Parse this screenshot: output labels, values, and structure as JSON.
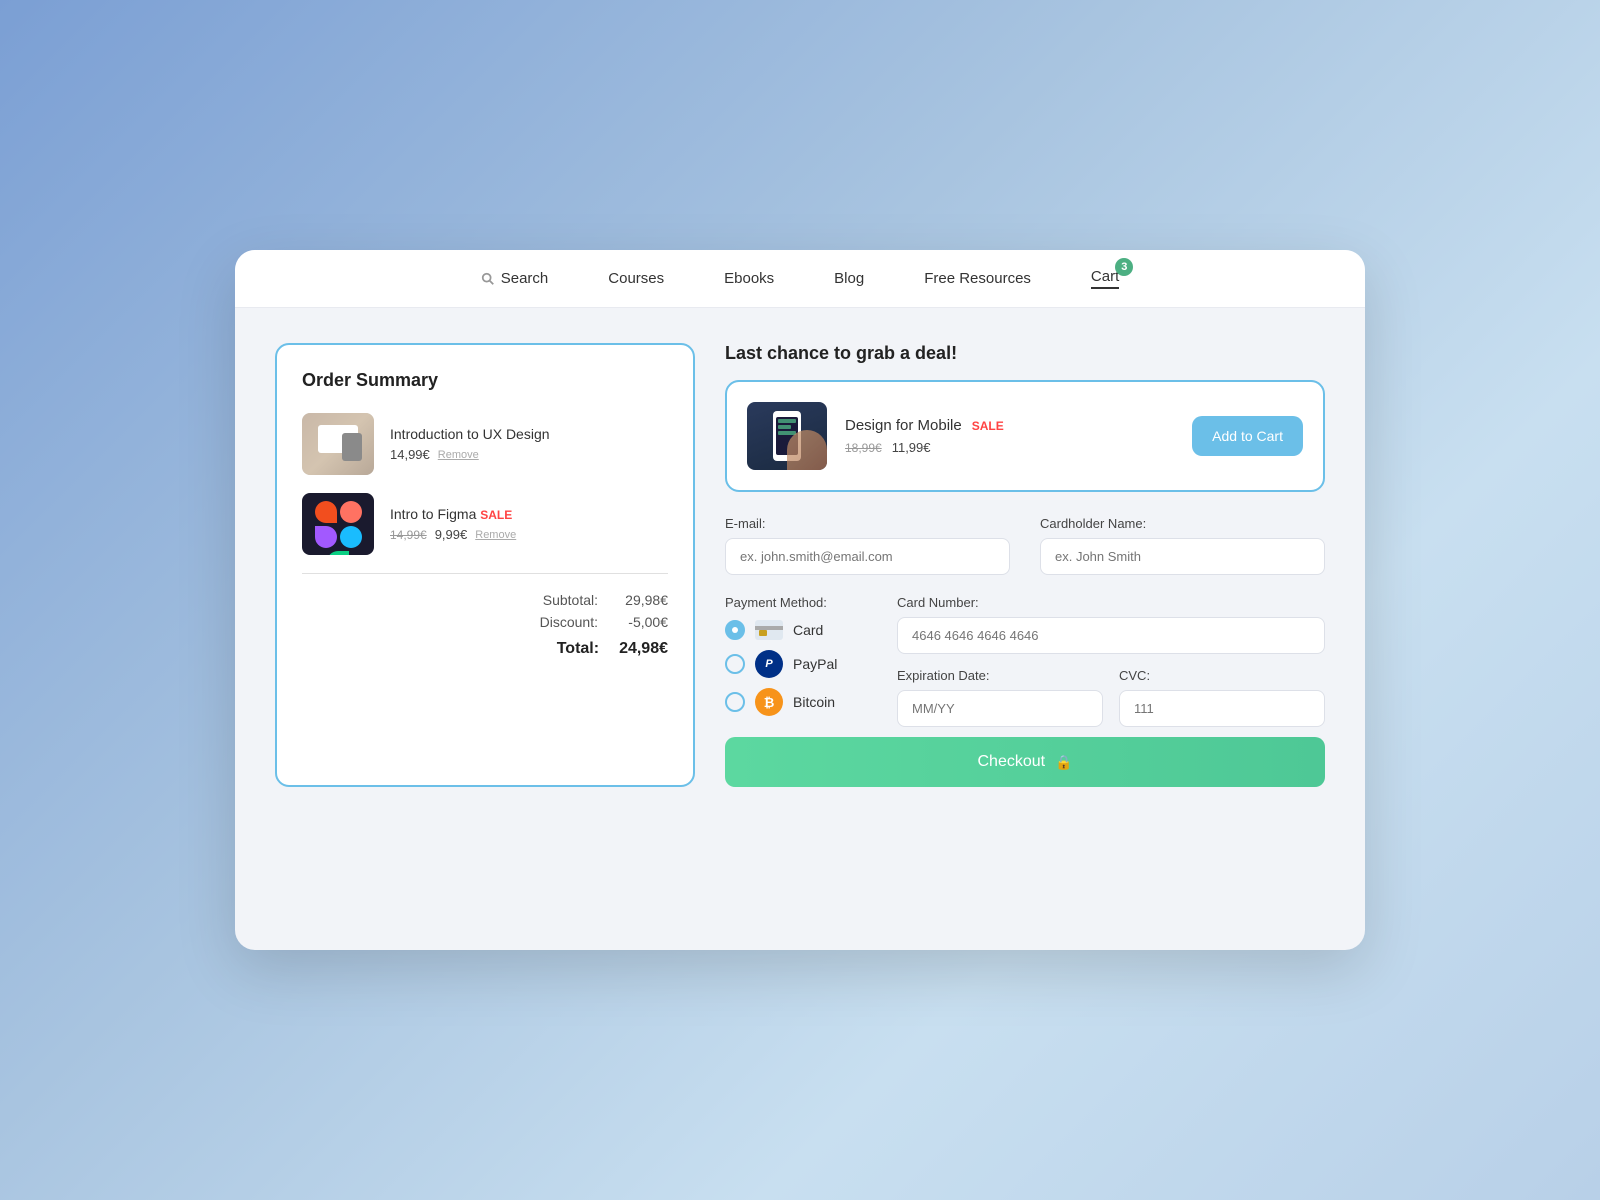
{
  "nav": {
    "search_label": "Search",
    "courses_label": "Courses",
    "ebooks_label": "Ebooks",
    "blog_label": "Blog",
    "free_resources_label": "Free Resources",
    "cart_label": "Cart",
    "cart_badge": "3"
  },
  "order_summary": {
    "title": "Order Summary",
    "items": [
      {
        "name": "Introduction to UX Design",
        "price": "14,99€",
        "remove_label": "Remove",
        "type": "ux"
      },
      {
        "name": "Intro to Figma",
        "sale_label": "SALE",
        "price_old": "14,99€",
        "price": "9,99€",
        "remove_label": "Remove",
        "type": "figma"
      }
    ],
    "subtotal_label": "Subtotal:",
    "subtotal_value": "29,98€",
    "discount_label": "Discount:",
    "discount_value": "-5,00€",
    "total_label": "Total:",
    "total_value": "24,98€"
  },
  "deal": {
    "title": "Last chance to grab a deal!",
    "name": "Design for Mobile",
    "sale_label": "SALE",
    "price_old": "18,99€",
    "price": "11,99€",
    "add_to_cart_label": "Add to Cart"
  },
  "form": {
    "email_label": "E-mail:",
    "email_placeholder": "ex. john.smith@email.com",
    "cardholder_label": "Cardholder Name:",
    "cardholder_placeholder": "ex. John Smith",
    "payment_method_label": "Payment Method:",
    "card_number_label": "Card Number:",
    "card_number_placeholder": "4646 4646 4646 4646",
    "expiration_label": "Expiration Date:",
    "expiration_placeholder": "MM/YY",
    "cvc_label": "CVC:",
    "cvc_placeholder": "111",
    "checkout_label": "Checkout"
  },
  "payment_options": [
    {
      "id": "card",
      "label": "Card",
      "selected": true
    },
    {
      "id": "paypal",
      "label": "PayPal",
      "selected": false
    },
    {
      "id": "bitcoin",
      "label": "Bitcoin",
      "selected": false
    }
  ]
}
